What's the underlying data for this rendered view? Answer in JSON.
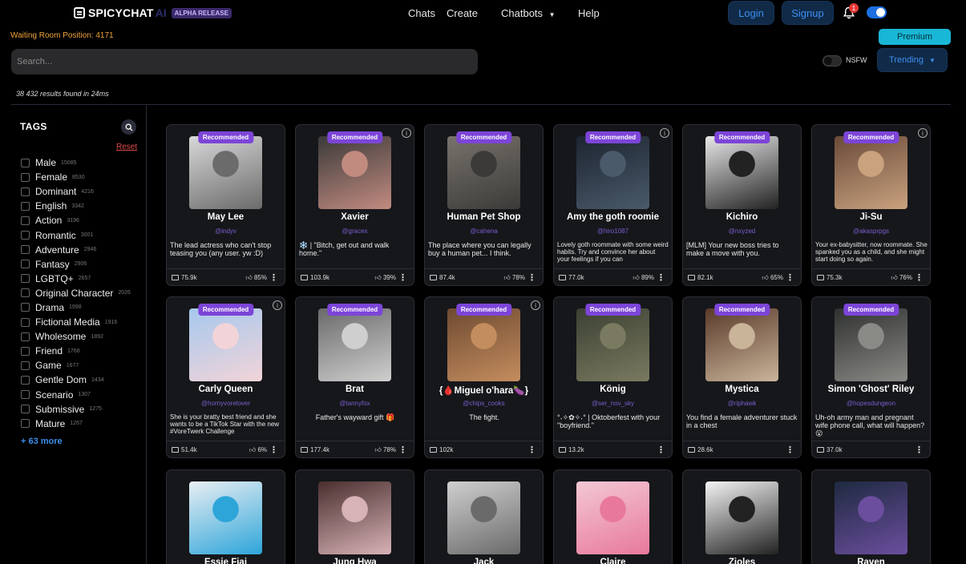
{
  "brand": {
    "name": "SPICYCHAT",
    "ai": "AI",
    "badge": "ALPHA RELEASE"
  },
  "nav": {
    "chats": "Chats",
    "create": "Create",
    "chatbots": "Chatbots",
    "help": "Help"
  },
  "auth": {
    "login": "Login",
    "signup": "Signup",
    "notifications": "1"
  },
  "waiting": "Waiting Room Position: 4171",
  "premium": "Premium",
  "search": {
    "placeholder": "Search..."
  },
  "nsfw": "NSFW",
  "sort": "Trending",
  "results": "38 432 results found in 24ms",
  "sidebar": {
    "title": "TAGS",
    "reset": "Reset",
    "more": "+ 63 more",
    "tags": [
      {
        "label": "Male",
        "count": "15085"
      },
      {
        "label": "Female",
        "count": "8530"
      },
      {
        "label": "Dominant",
        "count": "4216"
      },
      {
        "label": "English",
        "count": "3342"
      },
      {
        "label": "Action",
        "count": "3196"
      },
      {
        "label": "Romantic",
        "count": "3001"
      },
      {
        "label": "Adventure",
        "count": "2946"
      },
      {
        "label": "Fantasy",
        "count": "2906"
      },
      {
        "label": "LGBTQ+",
        "count": "2657"
      },
      {
        "label": "Original Character",
        "count": "2026"
      },
      {
        "label": "Drama",
        "count": "1998"
      },
      {
        "label": "Fictional Media",
        "count": "1916"
      },
      {
        "label": "Wholesome",
        "count": "1892"
      },
      {
        "label": "Friend",
        "count": "1768"
      },
      {
        "label": "Game",
        "count": "1677"
      },
      {
        "label": "Gentle Dom",
        "count": "1434"
      },
      {
        "label": "Scenario",
        "count": "1307"
      },
      {
        "label": "Submissive",
        "count": "1275"
      },
      {
        "label": "Mature",
        "count": "1267"
      }
    ]
  },
  "recommended_label": "Recommended",
  "cards": [
    {
      "name": "May Lee",
      "handle": "@indyv",
      "desc": "The lead actress who can't stop teasing you (any user. yw :D)",
      "messages": "75.9k",
      "rating": "85%"
    },
    {
      "name": "Xavier",
      "handle": "@gracex",
      "desc": "❄️ | \"Bitch, get out and walk home.\"",
      "messages": "103.9k",
      "rating": "39%"
    },
    {
      "name": "Human Pet Shop",
      "handle": "@cahena",
      "desc": "The place where you can legally buy a human pet... I think.",
      "messages": "87.4k",
      "rating": "78%"
    },
    {
      "name": "Amy the goth roomie",
      "handle": "@hiro1087",
      "desc": "Lovely goth roommate with some weird habits. Try and convince her about your feelings if you can",
      "messages": "77.0k",
      "rating": "89%"
    },
    {
      "name": "Kichiro",
      "handle": "@nxyzed",
      "desc": "[MLM] Your new boss tries to make a move with you.",
      "messages": "82.1k",
      "rating": "65%"
    },
    {
      "name": "Ji-Su",
      "handle": "@akasprpgs",
      "desc": "Your ex-babysitter, now roommate. She spanked you as a child, and she might start doing so again.",
      "messages": "75.3k",
      "rating": "76%"
    },
    {
      "name": "Carly Queen",
      "handle": "@hornyvorelover",
      "desc": "She is your bratty best friend and she wants to be a TikTok Star with the new #VoreTwerk Challenge",
      "messages": "51.4k",
      "rating": "6%"
    },
    {
      "name": "Brat",
      "handle": "@tannyfox",
      "desc": "Father's wayward gift 🎁",
      "messages": "177.4k",
      "rating": "78%"
    },
    {
      "name": "{🩸Miguel o'hara🍆}",
      "handle": "@chips_cooks",
      "desc": "The fight.",
      "messages": "102k",
      "rating": ""
    },
    {
      "name": "König",
      "handle": "@ser_nov_sky",
      "desc": "°˖✧✿✧˖° | Oktoberfest with your \"boyfriend.\"",
      "messages": "13.2k",
      "rating": ""
    },
    {
      "name": "Mystica",
      "handle": "@riphawk",
      "desc": "You find a female adventurer stuck in a chest",
      "messages": "28.6k",
      "rating": ""
    },
    {
      "name": "Simon 'Ghost' Riley",
      "handle": "@hopesdungeon",
      "desc": "Uh-oh army man and pregnant wife phone call, what will happen? 😮",
      "messages": "37.0k",
      "rating": ""
    },
    {
      "name": "Essie Fiai",
      "handle": "",
      "desc": "",
      "messages": "",
      "rating": ""
    },
    {
      "name": "Jung Hwa",
      "handle": "",
      "desc": "",
      "messages": "",
      "rating": ""
    },
    {
      "name": "Jack",
      "handle": "",
      "desc": "",
      "messages": "",
      "rating": ""
    },
    {
      "name": "Claire",
      "handle": "",
      "desc": "",
      "messages": "",
      "rating": ""
    },
    {
      "name": "Zioles",
      "handle": "",
      "desc": "",
      "messages": "",
      "rating": ""
    },
    {
      "name": "Raven",
      "handle": "",
      "desc": "",
      "messages": "",
      "rating": ""
    }
  ]
}
